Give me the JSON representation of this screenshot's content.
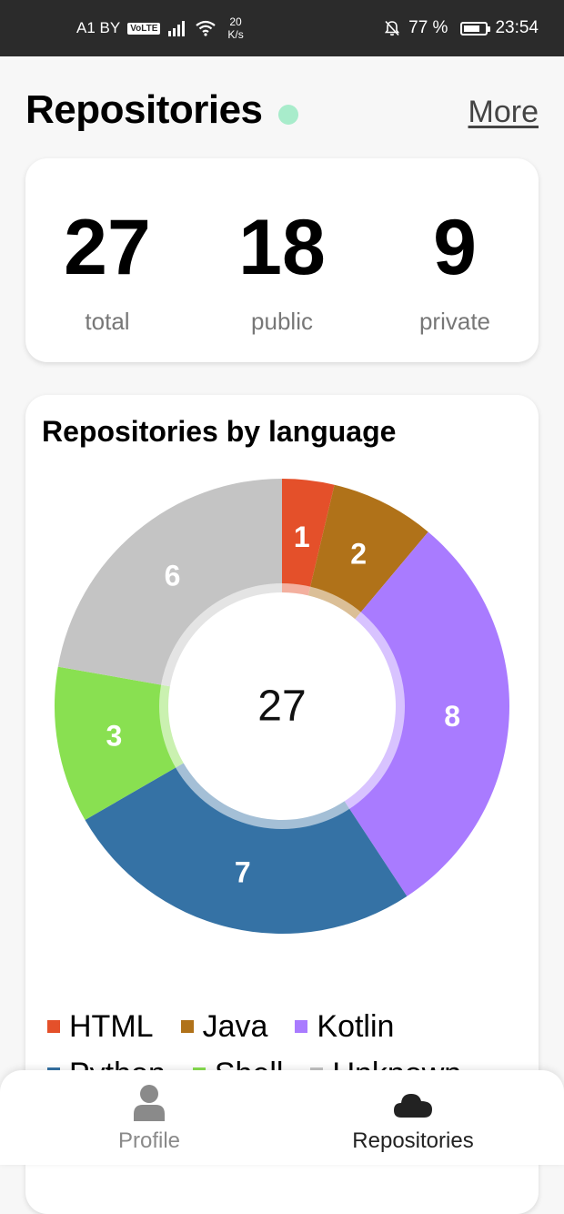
{
  "status_bar": {
    "carrier": "A1 BY",
    "volte": "VoLTE",
    "speed_value": "20",
    "speed_unit": "K/s",
    "battery": "77 %",
    "battery_level": 0.77,
    "time": "23:54"
  },
  "header": {
    "title": "Repositories",
    "more_label": "More",
    "dot_color": "#a8eccb"
  },
  "stats": {
    "total_value": "27",
    "total_label": "total",
    "public_value": "18",
    "public_label": "public",
    "private_value": "9",
    "private_label": "private"
  },
  "languages_card": {
    "title": "Repositories by language",
    "center_total": "27"
  },
  "chart_data": {
    "type": "pie",
    "title": "Repositories by language",
    "categories": [
      "HTML",
      "Java",
      "Kotlin",
      "Python",
      "Shell",
      "Unknown"
    ],
    "values": [
      1,
      2,
      8,
      7,
      3,
      6
    ],
    "colors": [
      "#e4502a",
      "#b07219",
      "#a97bff",
      "#3572a5",
      "#89e051",
      "#c4c4c4"
    ],
    "legend_position": "bottom"
  },
  "bottom_nav": {
    "profile_label": "Profile",
    "repositories_label": "Repositories"
  }
}
